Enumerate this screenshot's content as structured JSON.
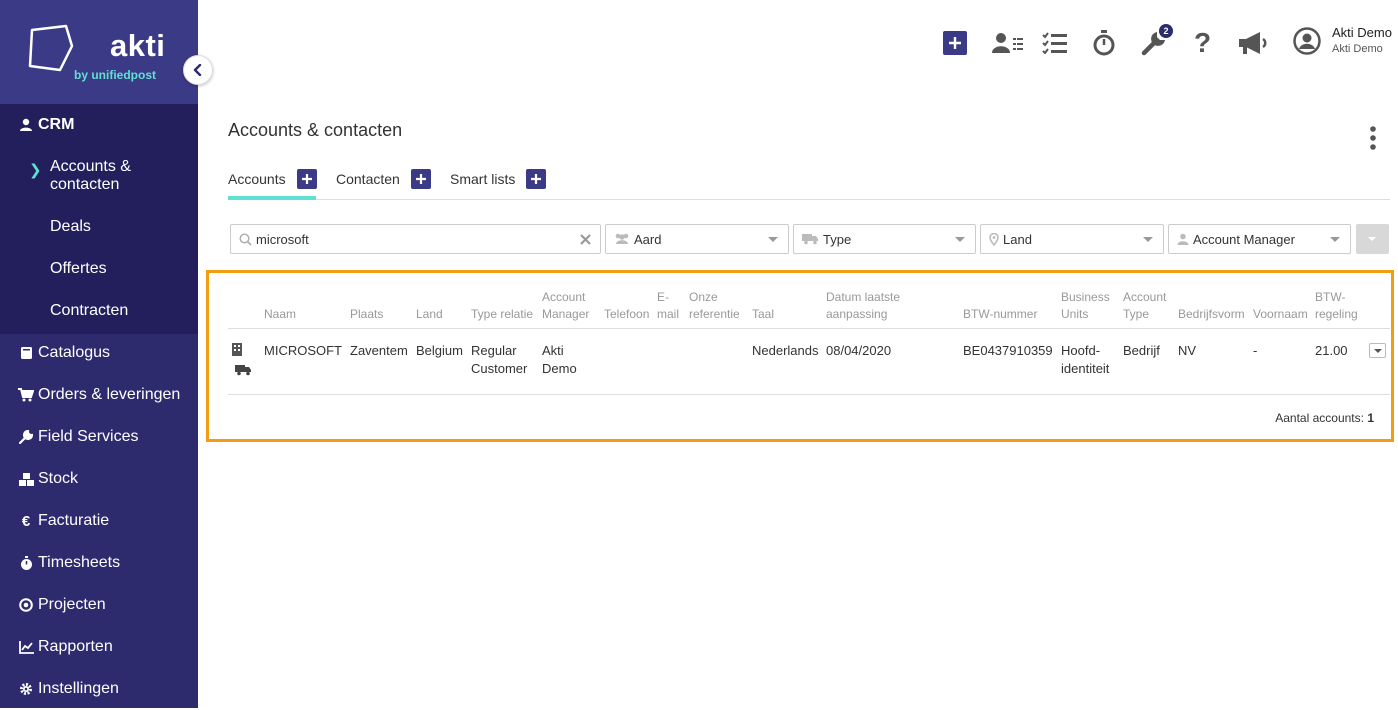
{
  "brand": {
    "name": "akti",
    "tagline": "by unifiedpost"
  },
  "sidebar": {
    "crm": {
      "label": "CRM",
      "icon": "user-icon"
    },
    "crm_items": [
      {
        "label_line1": "Accounts &",
        "label_line2": "contacten",
        "active": true
      },
      {
        "label": "Deals"
      },
      {
        "label": "Offertes"
      },
      {
        "label": "Contracten"
      }
    ],
    "items": [
      {
        "label": "Catalogus",
        "icon": "book-icon"
      },
      {
        "label": "Orders & leveringen",
        "icon": "cart-icon"
      },
      {
        "label": "Field Services",
        "icon": "wrench-icon"
      },
      {
        "label": "Stock",
        "icon": "boxes-icon"
      },
      {
        "label": "Facturatie",
        "icon": "euro-icon"
      },
      {
        "label": "Timesheets",
        "icon": "stopwatch-icon"
      },
      {
        "label": "Projecten",
        "icon": "target-icon"
      },
      {
        "label": "Rapporten",
        "icon": "chart-icon"
      },
      {
        "label": "Instellingen",
        "icon": "gear-icon"
      }
    ]
  },
  "topbar": {
    "badge_count": "2",
    "user_name": "Akti Demo",
    "user_company": "Akti Demo"
  },
  "page": {
    "title": "Accounts & contacten",
    "tabs": [
      {
        "label": "Accounts",
        "active": true
      },
      {
        "label": "Contacten"
      },
      {
        "label": "Smart lists"
      }
    ]
  },
  "filters": {
    "search_value": "microsoft",
    "aard": "Aard",
    "type": "Type",
    "land": "Land",
    "account_manager": "Account Manager"
  },
  "table": {
    "headers": {
      "naam": "Naam",
      "plaats": "Plaats",
      "land": "Land",
      "type_relatie": "Type relatie",
      "account_manager_1": "Account",
      "account_manager_2": "Manager",
      "telefoon": "Telefoon",
      "email_1": "E-",
      "email_2": "mail",
      "onze_ref_1": "Onze",
      "onze_ref_2": "referentie",
      "taal": "Taal",
      "datum_1": "Datum laatste",
      "datum_2": "aanpassing",
      "btw_nummer": "BTW-nummer",
      "business_1": "Business",
      "business_2": "Units",
      "account_type_1": "Account",
      "account_type_2": "Type",
      "bedrijfsvorm": "Bedrijfsvorm",
      "voornaam": "Voornaam",
      "btw_regeling_1": "BTW-",
      "btw_regeling_2": "regeling"
    },
    "rows": [
      {
        "naam": "MICROSOFT",
        "plaats": "Zaventem",
        "land": "Belgium",
        "type_relatie_1": "Regular",
        "type_relatie_2": "Customer",
        "account_manager_1": "Akti",
        "account_manager_2": "Demo",
        "taal": "Nederlands",
        "datum": "08/04/2020",
        "btw_nummer": "BE0437910359",
        "business_1": "Hoofd-",
        "business_2": "identiteit",
        "account_type": "Bedrijf",
        "bedrijfsvorm": "NV",
        "voornaam": "-",
        "btw_regeling": "21.00"
      }
    ],
    "footer_label": "Aantal accounts:",
    "footer_count": "1"
  },
  "colors": {
    "sidebar": "#2d2a6e",
    "accent": "#5fe0d2",
    "primary": "#3b3a86",
    "highlight": "#f39c12"
  }
}
